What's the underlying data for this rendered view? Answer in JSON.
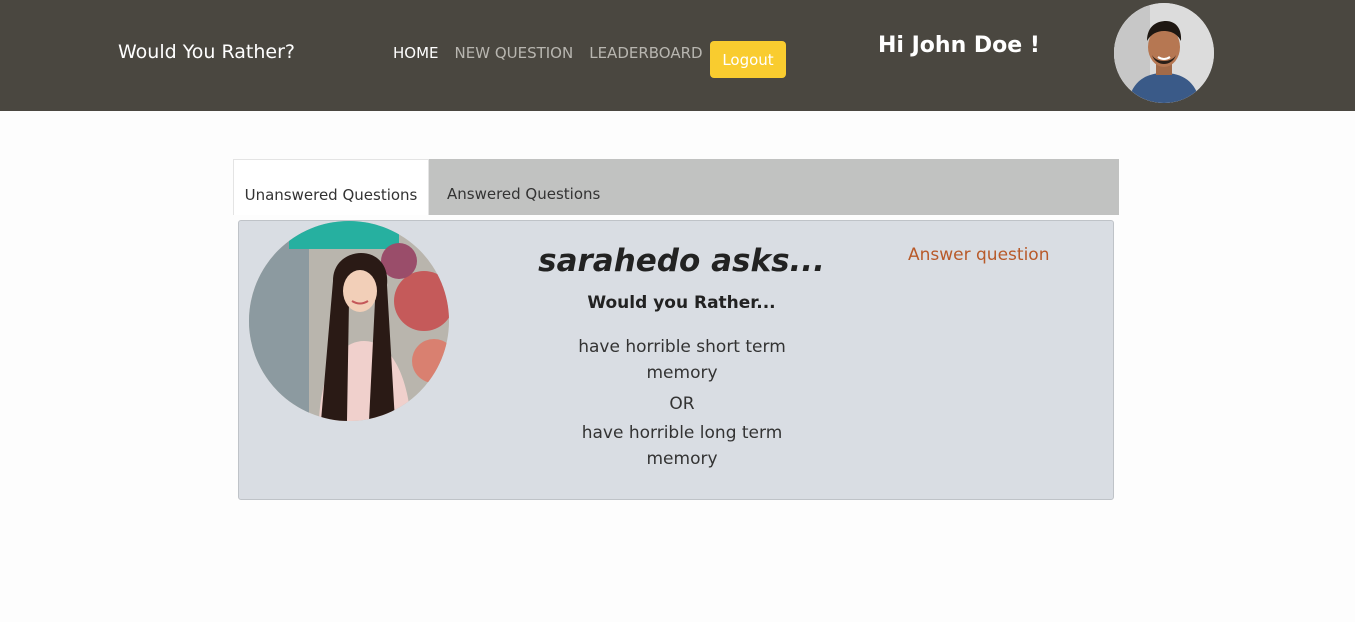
{
  "header": {
    "brand": "Would You Rather?",
    "nav": [
      "HOME",
      "NEW QUESTION",
      "LEADERBOARD"
    ],
    "logout_label": "Logout",
    "greeting": "Hi John Doe !"
  },
  "tabs": {
    "unanswered_label": "Unanswered Questions",
    "answered_label": "Answered Questions"
  },
  "question": {
    "asker": "sarahedo asks...",
    "prompt": "Would you Rather...",
    "option_one": "have horrible short term memory",
    "or_label": "OR",
    "option_two": "have horrible long term memory",
    "answer_link": "Answer question"
  },
  "colors": {
    "navbar": "#4a4740",
    "logout_button": "#f9cc2f",
    "card_background": "#d9dde3",
    "answer_link": "#b85a2a"
  }
}
